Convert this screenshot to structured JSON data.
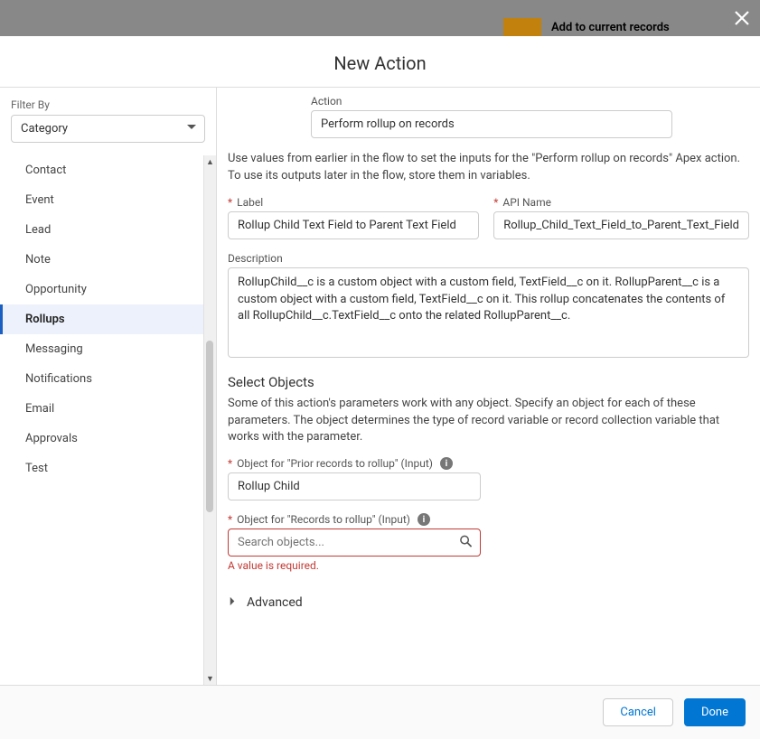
{
  "backdrop": {
    "add_text": "Add to current records"
  },
  "modal": {
    "title": "New Action"
  },
  "sidebar": {
    "filter_label": "Filter By",
    "filter_value": "Category",
    "items": [
      {
        "label": "Contact",
        "selected": false
      },
      {
        "label": "Event",
        "selected": false
      },
      {
        "label": "Lead",
        "selected": false
      },
      {
        "label": "Note",
        "selected": false
      },
      {
        "label": "Opportunity",
        "selected": false
      },
      {
        "label": "Rollups",
        "selected": true
      },
      {
        "label": "Messaging",
        "selected": false
      },
      {
        "label": "Notifications",
        "selected": false
      },
      {
        "label": "Email",
        "selected": false
      },
      {
        "label": "Approvals",
        "selected": false
      },
      {
        "label": "Test",
        "selected": false
      }
    ]
  },
  "main": {
    "action_label": "Action",
    "action_value": "Perform rollup on records",
    "intro": "Use values from earlier in the flow to set the inputs for the \"Perform rollup on records\" Apex action. To use its outputs later in the flow, store them in variables.",
    "label_label": "Label",
    "label_value": "Rollup Child Text Field to Parent Text Field",
    "api_label": "API Name",
    "api_value": "Rollup_Child_Text_Field_to_Parent_Text_Field",
    "desc_label": "Description",
    "desc_value": "RollupChild__c is a custom object with a custom field, TextField__c on it. RollupParent__c is a custom object with a custom field, TextField__c on it. This rollup concatenates the contents of all RollupChild__c.TextField__c onto the related RollupParent__c.",
    "select_objects_title": "Select Objects",
    "select_objects_help": "Some of this action's parameters work with any object. Specify an object for each of these parameters. The object determines the type of record variable or record collection variable that works with the parameter.",
    "prior_label": "Object for \"Prior records to rollup\" (Input)",
    "prior_value": "Rollup Child",
    "records_label": "Object for \"Records to rollup\" (Input)",
    "records_placeholder": "Search objects...",
    "records_error": "A value is required.",
    "advanced_label": "Advanced"
  },
  "footer": {
    "cancel": "Cancel",
    "done": "Done"
  },
  "icons": {
    "info_glyph": "i"
  }
}
